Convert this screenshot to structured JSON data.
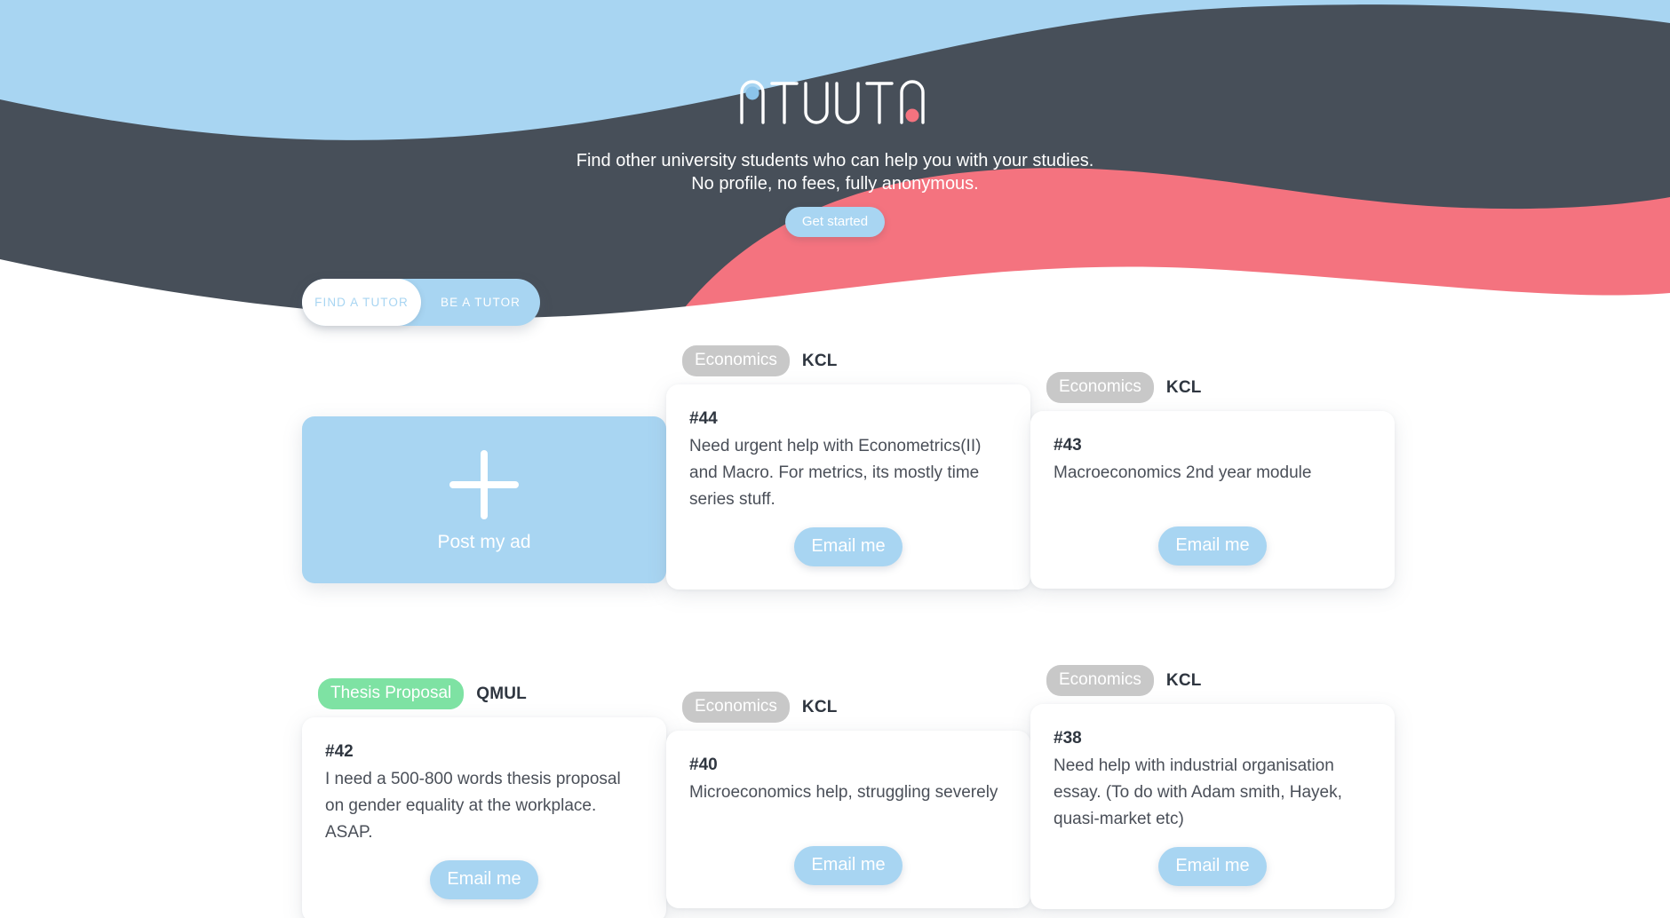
{
  "brand": {
    "logo_text": "ATUUTA",
    "logo_dot_left_color": "#8cc4ea",
    "logo_dot_right_color": "#f4737f"
  },
  "hero": {
    "tagline_line1": "Find other university students who can help you with your studies.",
    "tagline_line2": "No profile, no fees, fully anonymous.",
    "get_started_label": "Get started",
    "colors": {
      "sky": "#a8d5f2",
      "dark": "#474f59",
      "pink": "#f4737f",
      "white": "#ffffff"
    }
  },
  "toggle": {
    "find_label": "FIND A TUTOR",
    "be_label": "BE A TUTOR",
    "active": "FIND A TUTOR"
  },
  "post_ad": {
    "label": "Post my ad",
    "icon": "plus-icon"
  },
  "cards": [
    {
      "tag": "Economics",
      "tag_color": "gray",
      "university": "KCL",
      "id": "#44",
      "body": "Need urgent help with Econometrics(II) and Macro. For metrics, its mostly time series stuff.",
      "action": "Email me"
    },
    {
      "tag": "Economics",
      "tag_color": "gray",
      "university": "KCL",
      "id": "#43",
      "body": "Macroeconomics 2nd year module",
      "action": "Email me"
    },
    {
      "tag": "Thesis Proposal",
      "tag_color": "green",
      "university": "QMUL",
      "id": "#42",
      "body": "I need a 500-800 words thesis proposal on gender equality at the workplace. ASAP.",
      "action": "Email me"
    },
    {
      "tag": "Economics",
      "tag_color": "gray",
      "university": "KCL",
      "id": "#40",
      "body": "Microeconomics help, struggling severely",
      "action": "Email me"
    },
    {
      "tag": "Economics",
      "tag_color": "gray",
      "university": "KCL",
      "id": "#38",
      "body": "Need help with industrial organisation essay. (To do with Adam smith, Hayek, quasi-market etc)",
      "action": "Email me"
    }
  ]
}
